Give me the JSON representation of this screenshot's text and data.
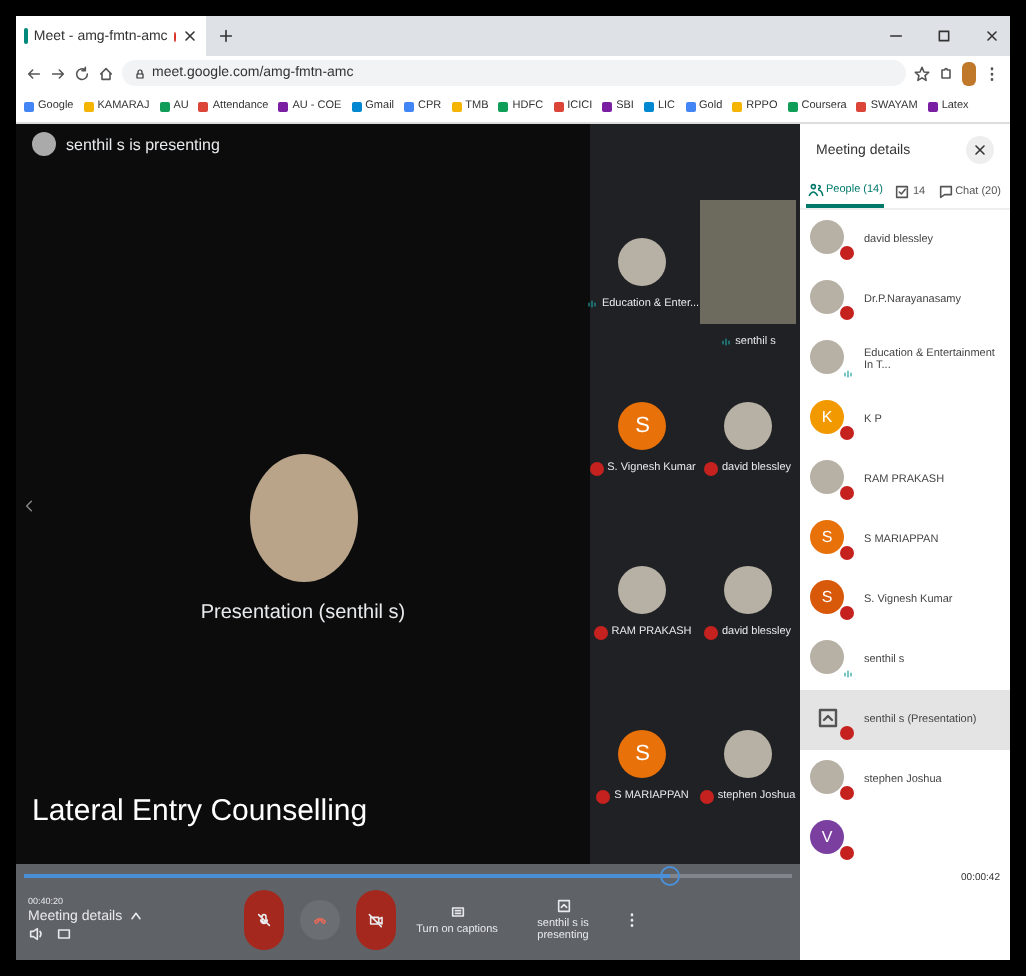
{
  "browser": {
    "tab_title": "Meet - amg-fmtn-amc",
    "url": "meet.google.com/amg-fmtn-amc",
    "bookmarks": [
      "Google",
      "KAMARAJ",
      "AU",
      "Attendance",
      "AU - COE",
      "Gmail",
      "CPR",
      "TMB",
      "HDFC",
      "ICICI",
      "SBI",
      "LIC",
      "Gold",
      "RPPO",
      "Coursera",
      "SWAYAM",
      "Latex"
    ]
  },
  "stage": {
    "presenter_banner": "senthil s is presenting",
    "presentation_label": "Presentation (senthil s)",
    "slide_title": "Lateral Entry Counselling"
  },
  "tiles": [
    {
      "name": "Education & Enter...",
      "kind": "photo",
      "muted": false
    },
    {
      "name": "senthil s",
      "kind": "video",
      "muted": false
    },
    {
      "name": "S. Vignesh Kumar",
      "kind": "letter",
      "letter": "S",
      "color": "#e8710a",
      "muted": true
    },
    {
      "name": "david blessley",
      "kind": "photo",
      "muted": true
    },
    {
      "name": "RAM PRAKASH",
      "kind": "photo",
      "muted": true
    },
    {
      "name": "david blessley",
      "kind": "photo",
      "muted": true
    },
    {
      "name": "S MARIAPPAN",
      "kind": "letter",
      "letter": "S",
      "color": "#e8710a",
      "muted": true
    },
    {
      "name": "stephen Joshua",
      "kind": "photo",
      "muted": true
    }
  ],
  "panel": {
    "title": "Meeting details",
    "tabs": [
      {
        "label": "People (14)",
        "kind": "people",
        "selected": true
      },
      {
        "label": "14",
        "kind": "tasks",
        "selected": false
      },
      {
        "label": "Chat (20)",
        "kind": "chat",
        "selected": false
      }
    ],
    "people": [
      {
        "name": "david blessley",
        "kind": "photo",
        "muted": true,
        "selected": false
      },
      {
        "name": "Dr.P.Narayanasamy",
        "kind": "photo",
        "muted": true,
        "selected": false
      },
      {
        "name": "Education & Entertainment In T...",
        "kind": "photo",
        "muted": false,
        "selected": false
      },
      {
        "name": "K P",
        "kind": "letter",
        "letter": "K",
        "color": "#f29900",
        "muted": true,
        "selected": false
      },
      {
        "name": "RAM PRAKASH",
        "kind": "photo",
        "muted": true,
        "selected": false
      },
      {
        "name": "S MARIAPPAN",
        "kind": "letter",
        "letter": "S",
        "color": "#e8710a",
        "muted": true,
        "selected": false
      },
      {
        "name": "S. Vignesh Kumar",
        "kind": "letter",
        "letter": "S",
        "color": "#d9590a",
        "muted": true,
        "selected": false
      },
      {
        "name": "senthil s",
        "kind": "photo",
        "muted": false,
        "selected": false
      },
      {
        "name": "senthil s (Presentation)",
        "kind": "screen",
        "muted": true,
        "selected": true
      },
      {
        "name": "stephen Joshua",
        "kind": "photo",
        "muted": true,
        "selected": false
      },
      {
        "kind": "letter",
        "letter": "V",
        "color": "#7b3fa0",
        "muted": true,
        "selected": false
      }
    ]
  },
  "controls": {
    "elapsed": "00:40:20",
    "details_label": "Meeting details",
    "captions_label": "Turn on captions",
    "presenting_label": "senthil s is presenting",
    "player_time": "00:00:42",
    "level": 0.84
  }
}
